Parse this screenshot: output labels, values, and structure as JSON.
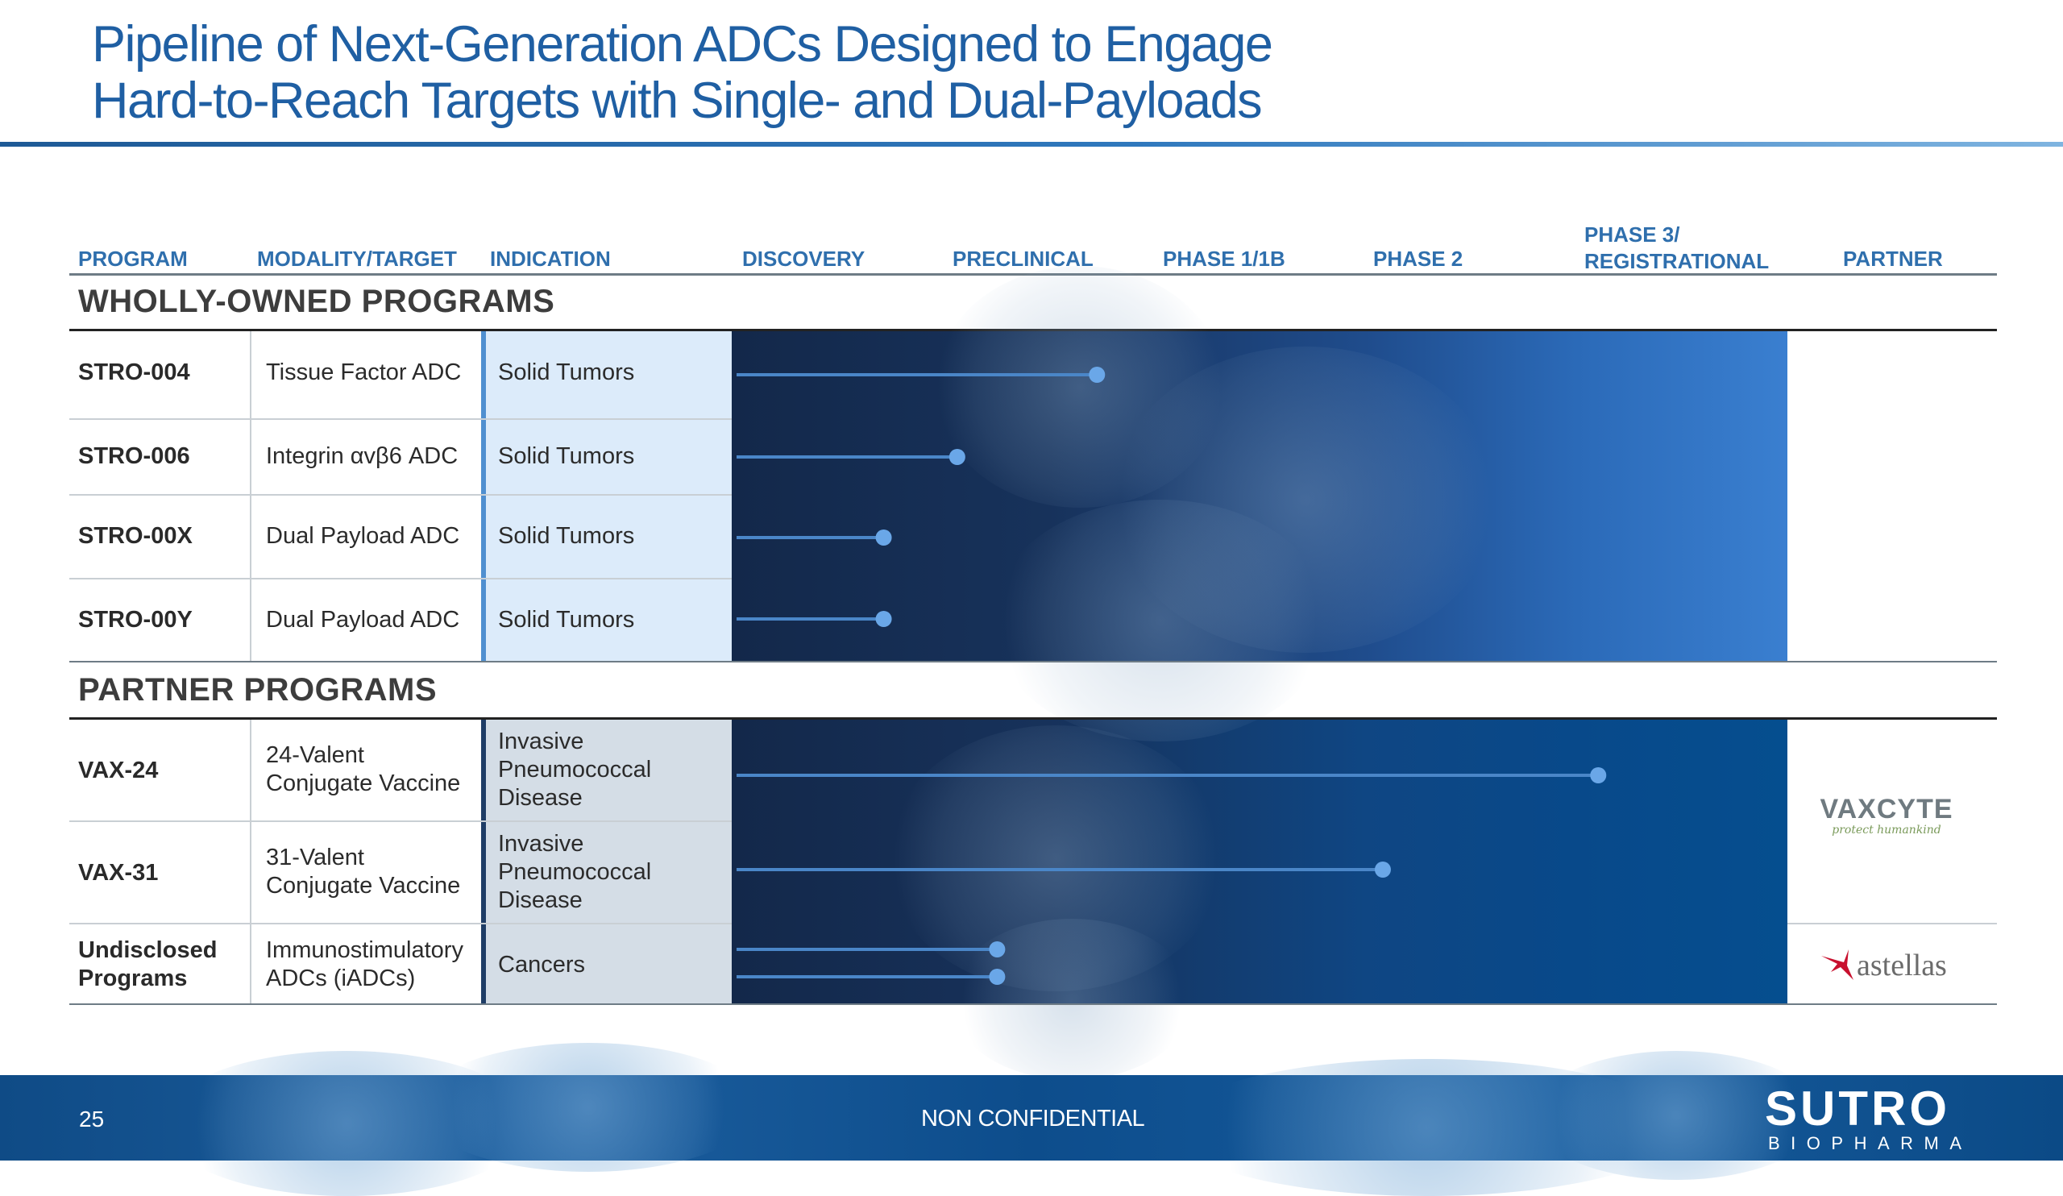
{
  "title": {
    "line1": "Pipeline of Next-Generation ADCs Designed to Engage",
    "line2": "Hard-to-Reach Targets with Single- and Dual-Payloads"
  },
  "columns": {
    "program": "PROGRAM",
    "modality": "MODALITY/TARGET",
    "indication": "INDICATION",
    "discovery": "DISCOVERY",
    "preclinical": "PRECLINICAL",
    "phase1": "PHASE 1/1B",
    "phase2": "PHASE 2",
    "phase3_line1": "PHASE 3/",
    "phase3_line2": "REGISTRATIONAL",
    "partner": "PARTNER"
  },
  "sections": {
    "wholly_owned": "WHOLLY-OWNED PROGRAMS",
    "partner": "PARTNER PROGRAMS"
  },
  "wholly_owned_rows": [
    {
      "program": "STRO-004",
      "modality": "Tissue Factor ADC",
      "indication": "Solid Tumors",
      "progress": 0.343
    },
    {
      "program": "STRO-006",
      "modality": "Integrin αvβ6 ADC",
      "indication": "Solid Tumors",
      "progress": 0.21
    },
    {
      "program": "STRO-00X",
      "modality": "Dual Payload ADC",
      "indication": "Solid Tumors",
      "progress": 0.14
    },
    {
      "program": "STRO-00Y",
      "modality": "Dual Payload ADC",
      "indication": "Solid Tumors",
      "progress": 0.14
    }
  ],
  "partner_rows": [
    {
      "program": "VAX-24",
      "modality_line1": "24-Valent",
      "modality_line2": "Conjugate Vaccine",
      "indication_line1": "Invasive",
      "indication_line2": "Pneumococcal",
      "indication_line3": "Disease",
      "progress": 0.82
    },
    {
      "program": "VAX-31",
      "modality_line1": "31-Valent",
      "modality_line2": "Conjugate Vaccine",
      "indication_line1": "Invasive",
      "indication_line2": "Pneumococcal",
      "indication_line3": "Disease",
      "progress": 0.615
    },
    {
      "program_line1": "Undisclosed",
      "program_line2": "Programs",
      "modality_line1": "Immunostimulatory",
      "modality_line2": "ADCs (iADCs)",
      "indication": "Cancers",
      "progress_a": 0.248,
      "progress_b": 0.248
    }
  ],
  "partners": {
    "vaxcyte": "VAXCYTE",
    "vaxcyte_tagline": "protect humankind",
    "astellas": "astellas"
  },
  "footer": {
    "page": "25",
    "confidentiality": "NON CONFIDENTIAL",
    "brand": "SUTRO",
    "brand_sub": "BIOPHARMA"
  },
  "colors": {
    "title": "#1f5fa3",
    "header_text": "#2f6fad",
    "bar_line": "#4a86c8",
    "bar_dot": "#6aa7e8",
    "footer": "#0f4b86"
  }
}
